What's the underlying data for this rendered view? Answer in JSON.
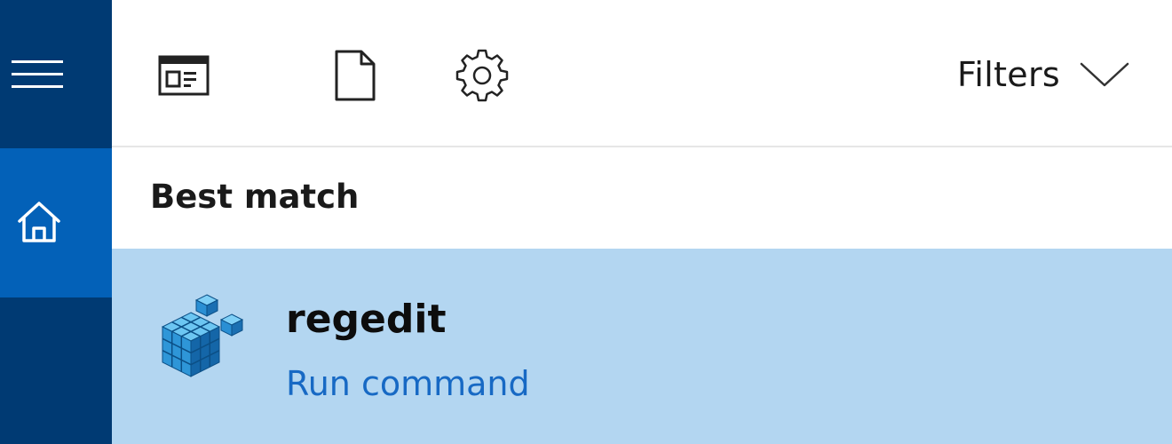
{
  "rail": {
    "menu_icon": "hamburger-menu-icon",
    "home_icon": "home-icon",
    "colors": {
      "rail_bg": "#003a73",
      "home_bg": "#0361b8"
    }
  },
  "toolbar": {
    "icons": [
      "apps-icon",
      "documents-icon",
      "settings-icon"
    ],
    "filters_label": "Filters",
    "filters_icon": "chevron-down-icon"
  },
  "results": {
    "section_title": "Best match",
    "best_match": {
      "icon": "regedit-icon",
      "title": "regedit",
      "subtitle": "Run command"
    },
    "colors": {
      "selected_bg": "#b3d6f1",
      "subtitle": "#1769c4"
    }
  }
}
